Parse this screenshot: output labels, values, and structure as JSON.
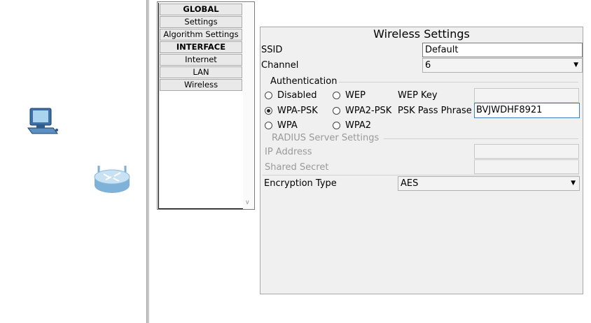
{
  "nav": {
    "items": [
      {
        "label": "GLOBAL",
        "header": true
      },
      {
        "label": "Settings",
        "header": false
      },
      {
        "label": "Algorithm Settings",
        "header": false
      },
      {
        "label": "INTERFACE",
        "header": true
      },
      {
        "label": "Internet",
        "header": false
      },
      {
        "label": "LAN",
        "header": false
      },
      {
        "label": "Wireless",
        "header": false
      }
    ]
  },
  "wireless": {
    "title": "Wireless Settings",
    "ssid_label": "SSID",
    "ssid_value": "Default",
    "channel_label": "Channel",
    "channel_value": "6",
    "auth_title": "Authentication",
    "radios": {
      "disabled": "Disabled",
      "wep": "WEP",
      "wpa_psk": "WPA-PSK",
      "wpa2_psk": "WPA2-PSK",
      "wpa": "WPA",
      "wpa2": "WPA2"
    },
    "selected_auth": "WPA-PSK",
    "wep_key_label": "WEP Key",
    "psk_label": "PSK Pass Phrase",
    "psk_value": "BVJWDHF8921",
    "radius_title": "RADIUS Server Settings",
    "ip_label": "IP Address",
    "secret_label": "Shared Secret",
    "encryption_label": "Encryption Type",
    "encryption_value": "AES"
  },
  "icons": {
    "pc": "pc-icon",
    "router": "wireless-router-icon"
  }
}
